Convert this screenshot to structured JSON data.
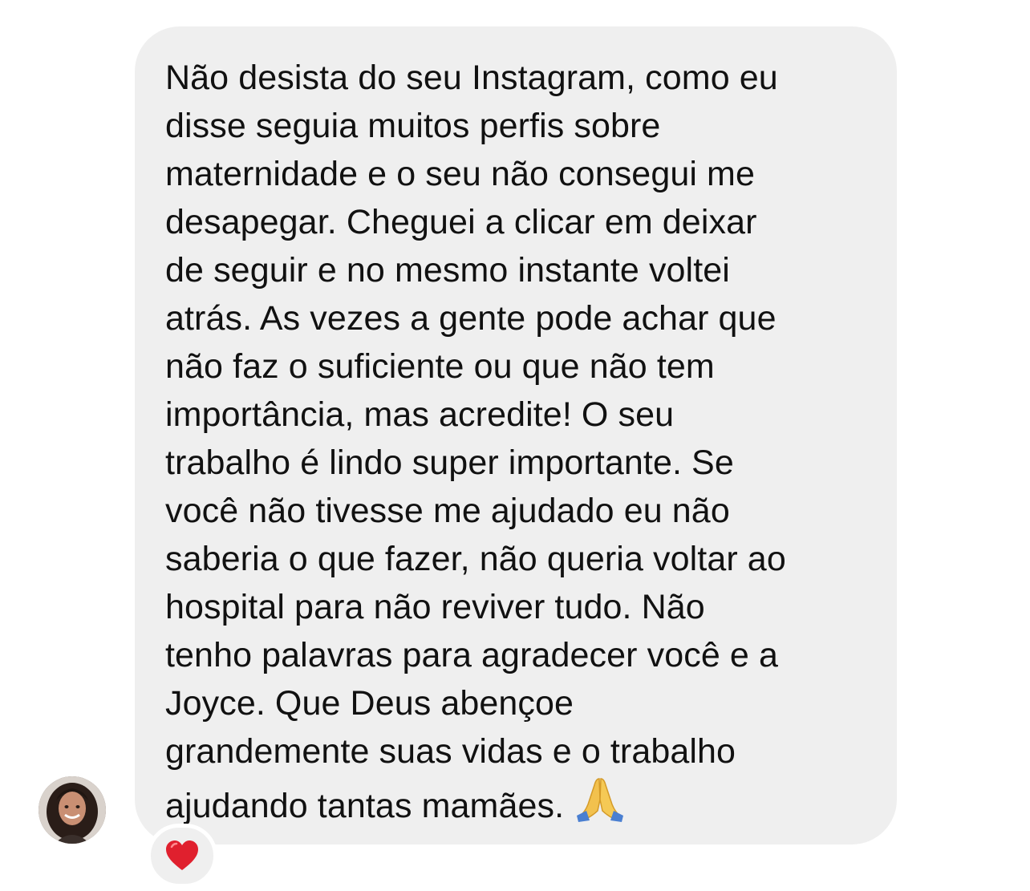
{
  "message": {
    "lines": [
      "Não desista do seu Instagram, como eu",
      "disse seguia muitos perfis sobre",
      "maternidade e o seu não consegui me",
      "desapegar. Cheguei a clicar em deixar",
      "de seguir e no mesmo instante voltei",
      "atrás. As vezes a gente pode achar que",
      "não faz o suficiente ou que não tem",
      "importância, mas acredite! O seu",
      "trabalho é lindo super importante. Se",
      "você não tivesse me ajudado eu não",
      "saberia o que fazer, não queria voltar ao",
      "hospital para não reviver tudo. Não",
      "tenho palavras para agradecer você e a",
      "Joyce. Que Deus abençoe",
      "grandemente suas vidas e o trabalho",
      "ajudando tantas mamães."
    ],
    "trailing_emoji": "folded-hands-icon",
    "bubble_color": "#efefef",
    "text_color": "#111111"
  },
  "sender": {
    "avatar": "avatar"
  },
  "reaction": {
    "emoji": "red-heart-icon",
    "color": "#e0202e"
  }
}
